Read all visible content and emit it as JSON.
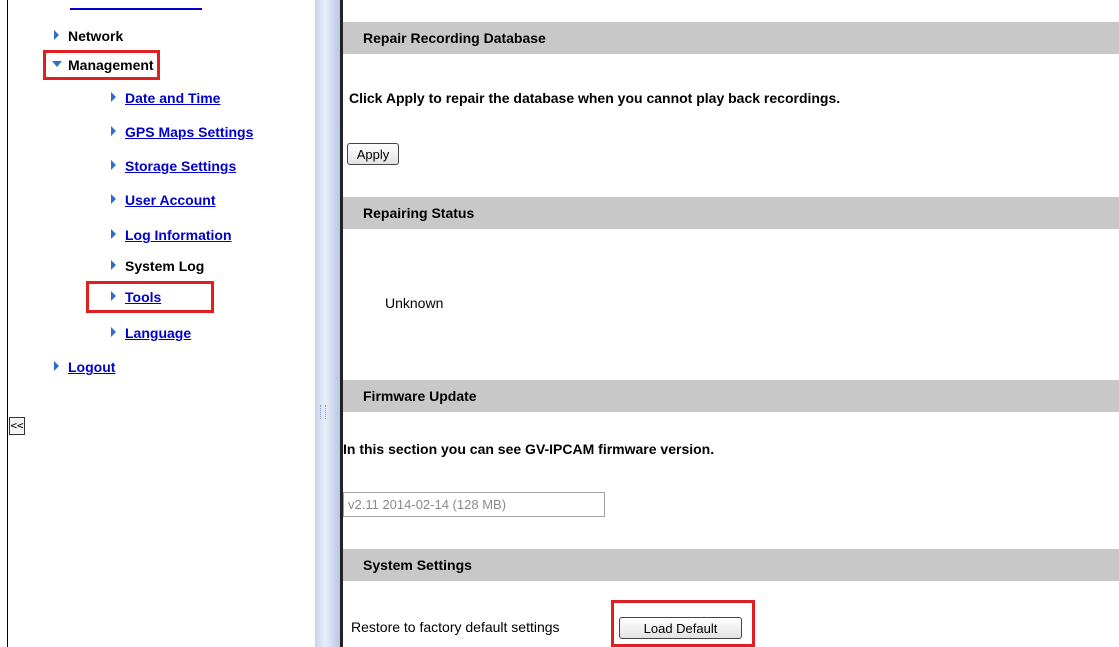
{
  "sidebar": {
    "items": [
      {
        "label": "Network",
        "link": false
      },
      {
        "label": "Management",
        "link": false
      },
      {
        "label": "Date and Time",
        "link": true
      },
      {
        "label": "GPS Maps Settings",
        "link": true
      },
      {
        "label": "Storage Settings",
        "link": true
      },
      {
        "label": "User Account",
        "link": true
      },
      {
        "label": "Log Information",
        "link": true
      },
      {
        "label": "System Log",
        "link": false
      },
      {
        "label": "Tools",
        "link": true
      },
      {
        "label": "Language",
        "link": true
      },
      {
        "label": "Logout",
        "link": true
      }
    ],
    "collapse_label": "<<"
  },
  "content": {
    "repair_db": {
      "title": "Repair Recording Database",
      "instruction": "Click Apply to repair the database when you cannot play back recordings.",
      "apply_label": "Apply"
    },
    "repair_status": {
      "title": "Repairing Status",
      "value": "Unknown"
    },
    "firmware": {
      "title": "Firmware Update",
      "description": "In this section you can see GV-IPCAM firmware version.",
      "version": "v2.11 2014-02-14 (128 MB)"
    },
    "system_settings": {
      "title": "System Settings",
      "restore_label": "Restore to factory default settings",
      "load_default_label": "Load Default"
    }
  },
  "colors": {
    "highlight": "#e02020",
    "link": "#0000cc",
    "section_bar": "#c8c8c8",
    "arrow": "#2f6fc6"
  }
}
